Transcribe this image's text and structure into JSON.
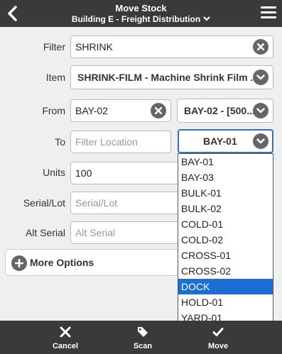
{
  "header": {
    "title": "Move Stock",
    "subtitle": "Building E - Freight Distribution"
  },
  "form": {
    "filter": {
      "label": "Filter",
      "value": "SHRINK"
    },
    "item": {
      "label": "Item",
      "value": "SHRINK-FILM - Machine Shrink Film ..."
    },
    "from": {
      "label": "From",
      "input_value": "BAY-02",
      "select_value": "BAY-02 - [500..."
    },
    "to": {
      "label": "To",
      "placeholder": "Filter Location",
      "select_value": "BAY-01"
    },
    "units": {
      "label": "Units",
      "value": "100"
    },
    "serial_lot": {
      "label": "Serial/Lot",
      "placeholder": "Serial/Lot"
    },
    "alt_serial": {
      "label": "Alt Serial",
      "placeholder": "Alt Serial"
    }
  },
  "more_options": {
    "label": "More Options"
  },
  "dropdown": {
    "options": [
      "BAY-01",
      "BAY-03",
      "BULK-01",
      "BULK-02",
      "COLD-01",
      "COLD-02",
      "CROSS-01",
      "CROSS-02",
      "DOCK",
      "HOLD-01",
      "YARD-01"
    ],
    "highlighted": "DOCK"
  },
  "footer": {
    "cancel": "Cancel",
    "scan": "Scan",
    "move": "Move"
  }
}
